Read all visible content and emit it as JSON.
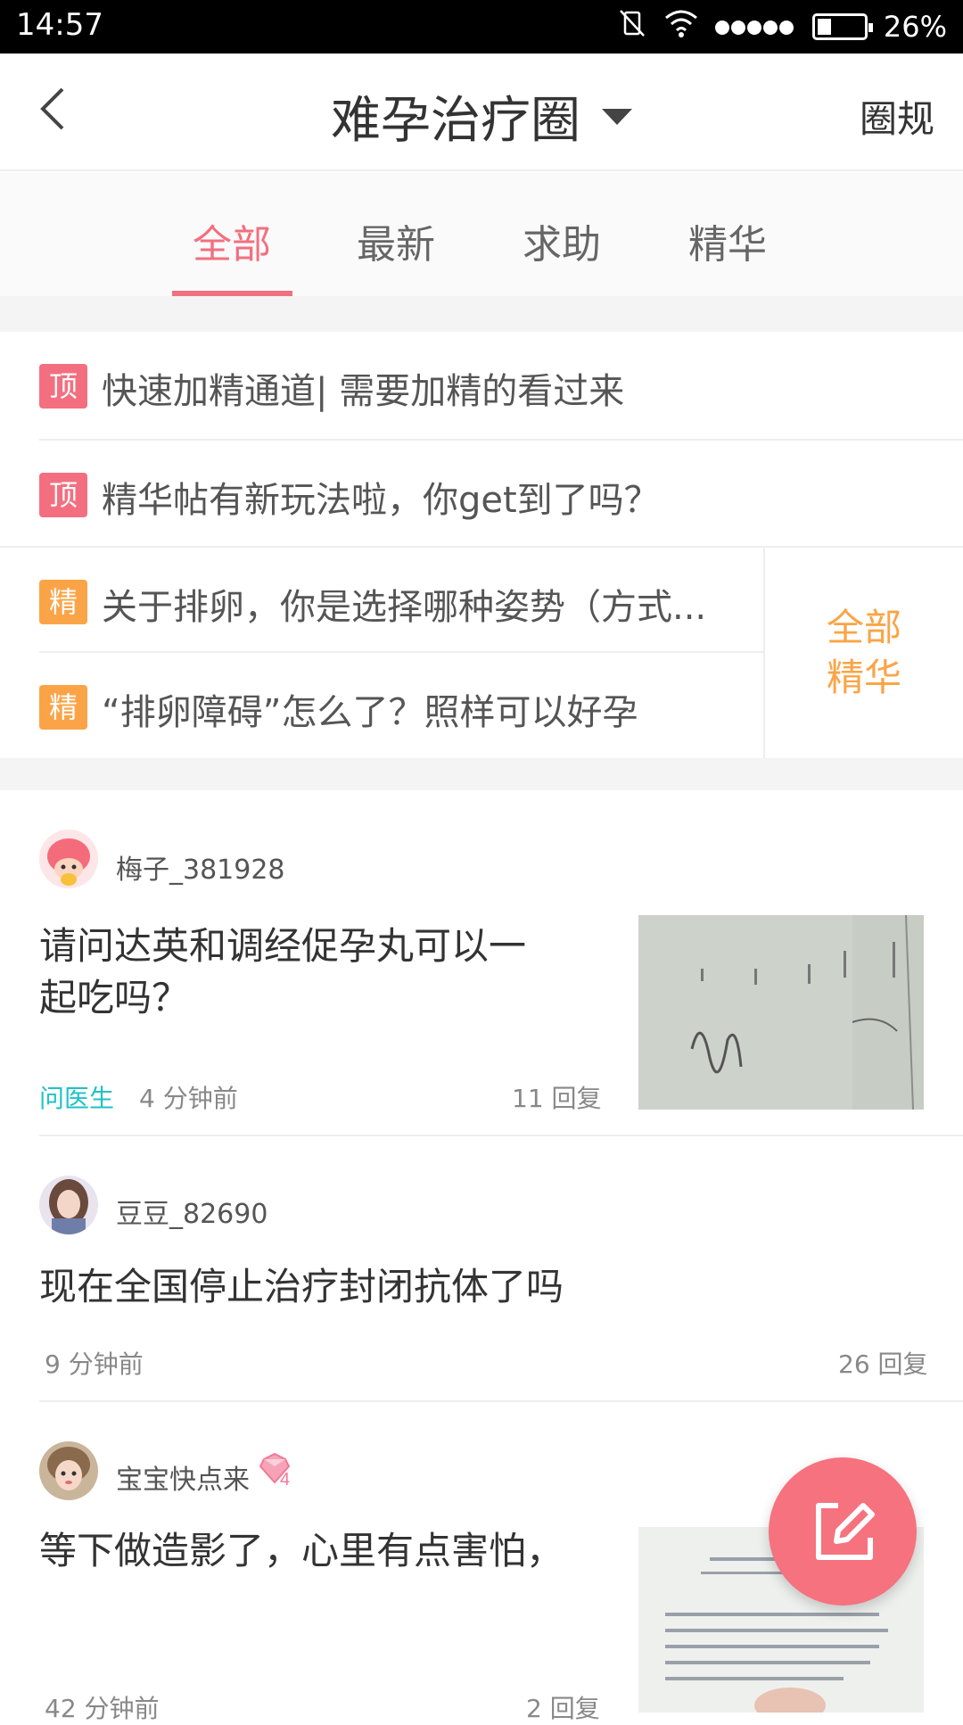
{
  "status_bar": {
    "time": "14:57",
    "battery": "26%",
    "battery_level": 0.26
  },
  "header": {
    "title": "难孕治疗圈",
    "rules_label": "圈规"
  },
  "tabs": [
    {
      "label": "全部",
      "active": true
    },
    {
      "label": "最新",
      "active": false
    },
    {
      "label": "求助",
      "active": false
    },
    {
      "label": "精华",
      "active": false
    }
  ],
  "pinned": [
    {
      "badge": "顶",
      "text": "快速加精通道| 需要加精的看过来"
    },
    {
      "badge": "顶",
      "text": "精华帖有新玩法啦，你get到了吗？"
    }
  ],
  "essence": [
    {
      "badge": "精",
      "text": "关于排卵，你是选择哪种姿势（方式..."
    },
    {
      "badge": "精",
      "text": "“排卵障碍”怎么了？照样可以好孕"
    }
  ],
  "all_essence": {
    "line1": "全部",
    "line2": "精华"
  },
  "posts": [
    {
      "user": "梅子_381928",
      "title_line1": "请问达英和调经促孕丸可以一",
      "title_line2": "起吃吗？",
      "tag": "问医生",
      "time": "4 分钟前",
      "replies": "11 回复"
    },
    {
      "user": "豆豆_82690",
      "title": "现在全国停止治疗封闭抗体了吗",
      "time": "9 分钟前",
      "replies": "26 回复"
    },
    {
      "user": "宝宝快点来",
      "level": "4",
      "title": "等下做造影了，心里有点害怕，",
      "time": "42 分钟前",
      "replies": "2 回复"
    }
  ],
  "colors": {
    "accent": "#f36f7f",
    "essence": "#fba447",
    "doctor_tag": "#1ec1c8"
  }
}
